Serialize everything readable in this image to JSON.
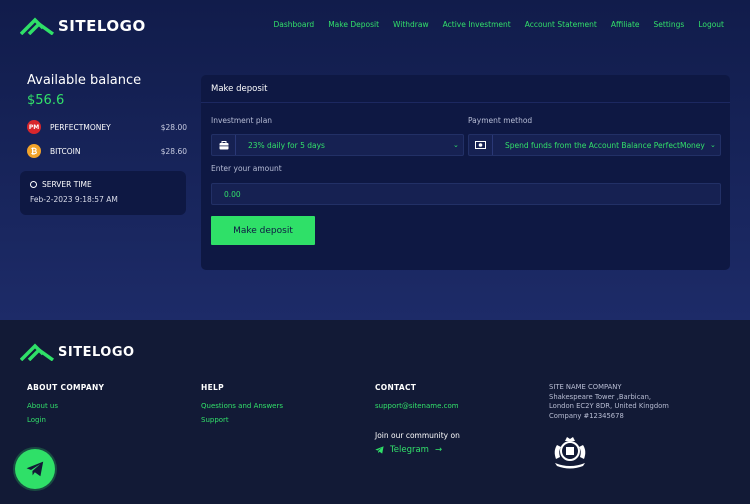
{
  "header": {
    "logo_text": "SITELOGO",
    "nav": [
      {
        "label": "Dashboard"
      },
      {
        "label": "Make Deposit"
      },
      {
        "label": "Withdraw"
      },
      {
        "label": "Active Investment"
      },
      {
        "label": "Account Statement"
      },
      {
        "label": "Affiliate"
      },
      {
        "label": "Settings"
      },
      {
        "label": "Logout"
      }
    ]
  },
  "balance": {
    "title": "Available balance",
    "value": "$56.6",
    "coins": [
      {
        "icon": "perfectmoney-icon",
        "badge": "PM",
        "name": "PERFECTMONEY",
        "amount": "$28.00",
        "color": "#d8262c"
      },
      {
        "icon": "bitcoin-icon",
        "badge": "₿",
        "name": "BITCOIN",
        "amount": "$28.60",
        "color": "#f2a32a"
      }
    ]
  },
  "server": {
    "label": "SERVER TIME",
    "time": "Feb-2-2023 9:18:57 AM"
  },
  "deposit": {
    "title": "Make deposit",
    "plan_label": "Investment plan",
    "plan_value": "23% daily for 5 days",
    "method_label": "Payment method",
    "method_value": "Spend funds from the Account Balance PerfectMoney",
    "amount_label": "Enter your amount",
    "amount_value": "0.00",
    "submit_label": "Make deposit"
  },
  "footer": {
    "logo_text": "SITELOGO",
    "about": {
      "title": "ABOUT COMPANY",
      "links": [
        "About us",
        "Login"
      ]
    },
    "help": {
      "title": "HELP",
      "links": [
        "Questions and Answers",
        "Support"
      ]
    },
    "contact": {
      "title": "CONTACT",
      "email": "support@sitename.com",
      "join": "Join our community on",
      "telegram": "Telegram"
    },
    "company": {
      "lines": [
        "SITE NAME COMPANY",
        "Shakespeare Tower ,Barbican,",
        "London EC2Y 8DR, United Kingdom",
        "Company #12345678"
      ]
    }
  },
  "colors": {
    "accent": "#2fe068",
    "background": "#1b2760",
    "card": "#0e1843",
    "footer": "#121a36"
  }
}
